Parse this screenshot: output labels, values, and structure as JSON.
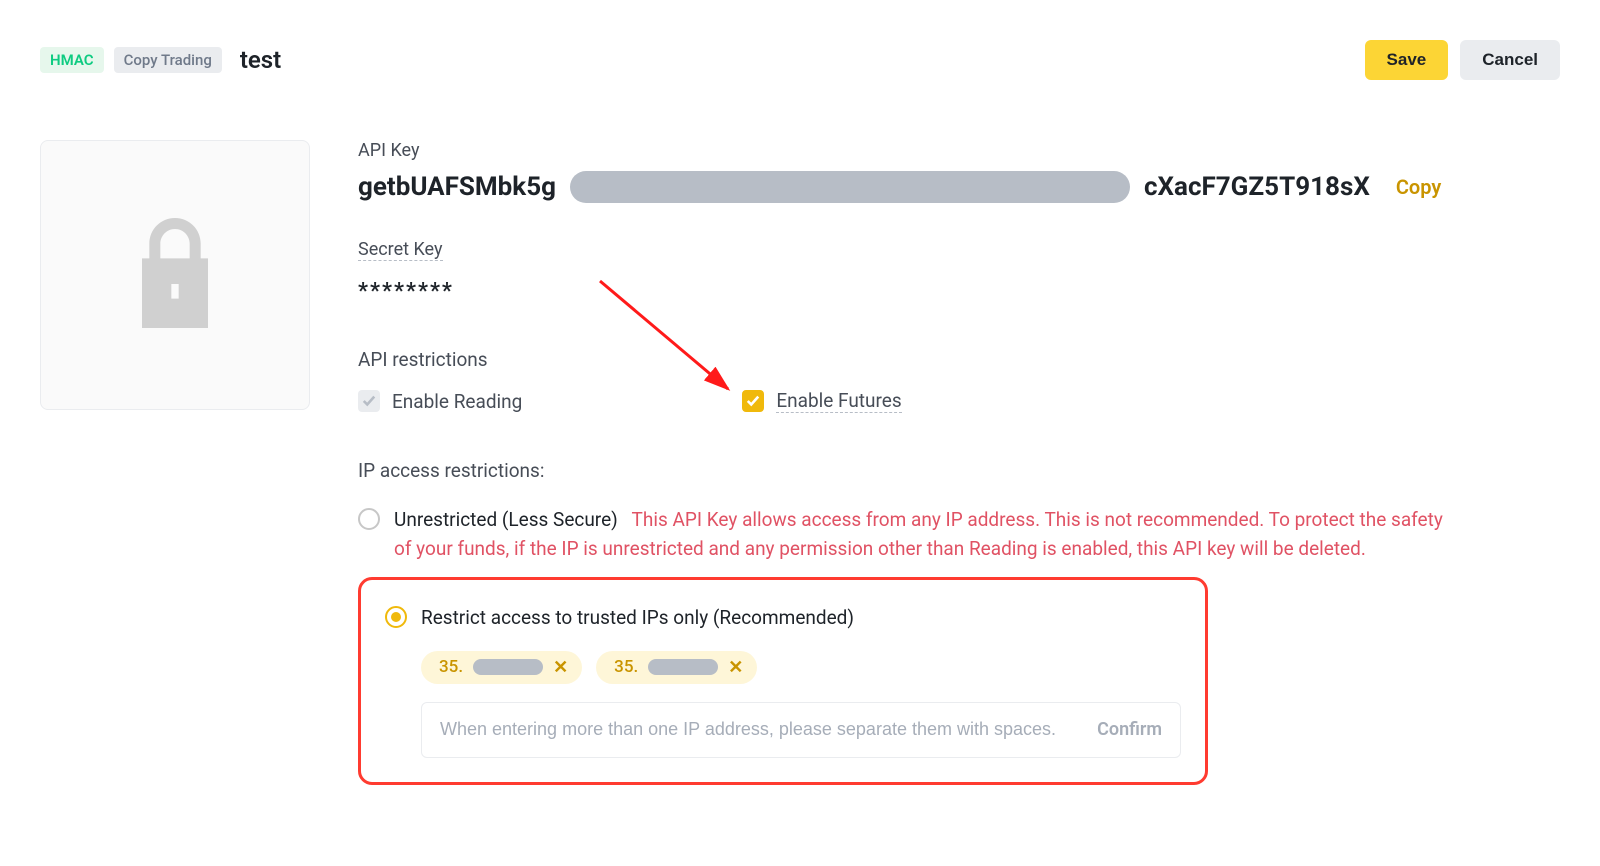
{
  "header": {
    "tag_hmac": "HMAC",
    "tag_copytrading": "Copy Trading",
    "title": "test",
    "save_label": "Save",
    "cancel_label": "Cancel"
  },
  "api_key": {
    "label": "API Key",
    "value_prefix": "getbUAFSMbk5g",
    "value_suffix": "cXacF7GZ5T918sX",
    "copy_label": "Copy"
  },
  "secret_key": {
    "label": "Secret Key",
    "value": "********"
  },
  "api_restrictions": {
    "title": "API restrictions",
    "enable_reading": "Enable Reading",
    "enable_futures": "Enable Futures"
  },
  "ip_restrictions": {
    "title": "IP access restrictions:",
    "unrestricted_label": "Unrestricted (Less Secure)",
    "unrestricted_warning": "This API Key allows access from any IP address. This is not recommended. To protect the safety of your funds, if the IP is unrestricted and any permission other than Reading is enabled, this API key will be deleted.",
    "restricted_label": "Restrict access to trusted IPs only (Recommended)",
    "chips": [
      {
        "prefix": "35."
      },
      {
        "prefix": "35."
      }
    ],
    "input_placeholder": "When entering more than one IP address, please separate them with spaces.",
    "confirm_label": "Confirm"
  }
}
